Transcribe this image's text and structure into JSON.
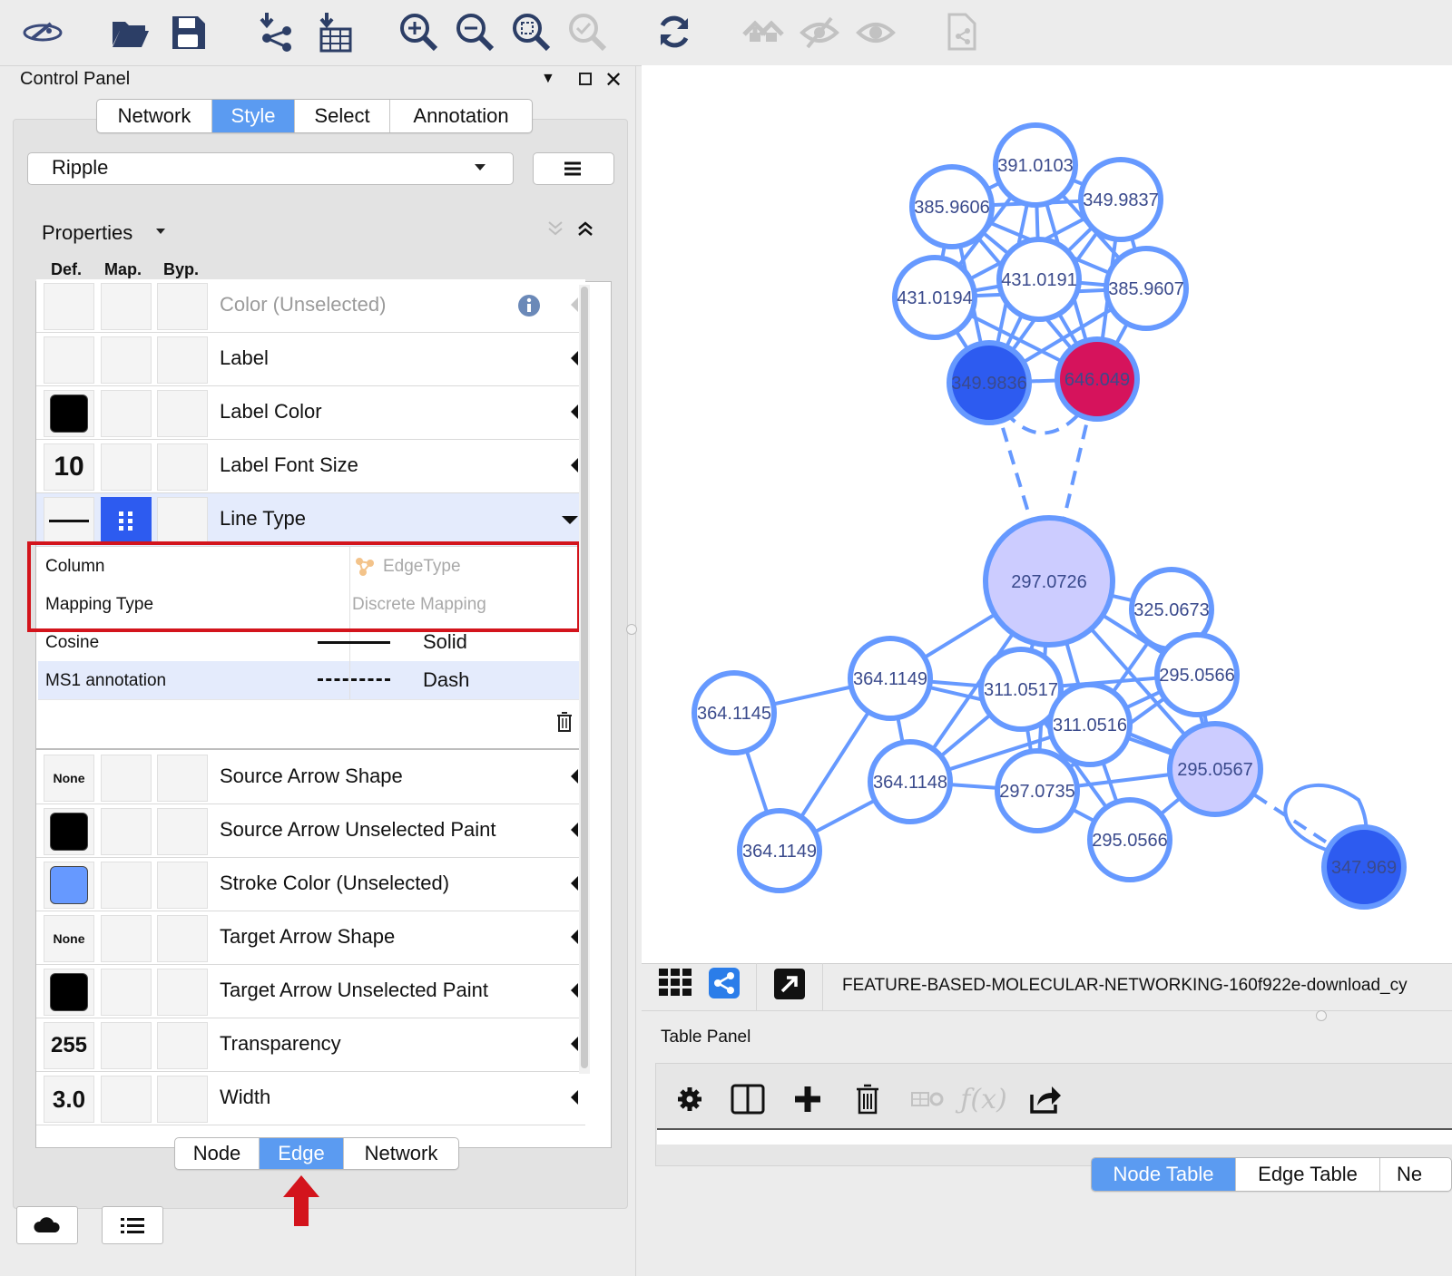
{
  "control_panel": {
    "title": "Control Panel",
    "top_tabs": [
      "Network",
      "Style",
      "Select",
      "Annotation"
    ],
    "active_top_tab": "Style",
    "style_name": "Ripple",
    "properties_label": "Properties",
    "column_headers": [
      "Def.",
      "Map.",
      "Byp."
    ],
    "properties": [
      {
        "label": "Color (Unselected)",
        "default": "",
        "disabled": true
      },
      {
        "label": "Label",
        "default": ""
      },
      {
        "label": "Label Color",
        "default_color": "#000000"
      },
      {
        "label": "Label Font Size",
        "default": "10"
      },
      {
        "label": "Line Type",
        "expanded": true
      },
      {
        "label": "Source Arrow Shape",
        "default": "None"
      },
      {
        "label": "Source Arrow Unselected Paint",
        "default_color": "#000000"
      },
      {
        "label": "Stroke Color (Unselected)",
        "default_color": "#6699ff"
      },
      {
        "label": "Target Arrow Shape",
        "default": "None"
      },
      {
        "label": "Target Arrow Unselected Paint",
        "default_color": "#000000"
      },
      {
        "label": "Transparency",
        "default": "255"
      },
      {
        "label": "Width",
        "default": "3.0"
      }
    ],
    "mapping": {
      "column_label": "Column",
      "column_value": "EdgeType",
      "mapping_type_label": "Mapping Type",
      "mapping_type_value": "Discrete Mapping",
      "entries": [
        {
          "key": "Cosine",
          "value": "Solid"
        },
        {
          "key": "MS1 annotation",
          "value": "Dash"
        }
      ]
    },
    "bottom_tabs": [
      "Node",
      "Edge",
      "Network"
    ],
    "active_bottom_tab": "Edge"
  },
  "network_view": {
    "title": "FEATURE-BASED-MOLECULAR-NETWORKING-160f922e-download_cy",
    "nodes": [
      {
        "id": "n1",
        "label": "391.0103",
        "kind": "plain"
      },
      {
        "id": "n2",
        "label": "385.9606",
        "kind": "plain"
      },
      {
        "id": "n3",
        "label": "349.9837",
        "kind": "plain"
      },
      {
        "id": "n4",
        "label": "431.0194",
        "kind": "plain"
      },
      {
        "id": "n5",
        "label": "431.0191",
        "kind": "plain"
      },
      {
        "id": "n6",
        "label": "385.9607",
        "kind": "plain"
      },
      {
        "id": "n7",
        "label": "349.9836",
        "kind": "blue"
      },
      {
        "id": "n8",
        "label": "646.049",
        "kind": "magenta"
      },
      {
        "id": "n9",
        "label": "297.0726",
        "kind": "lavender"
      },
      {
        "id": "n10",
        "label": "325.0673",
        "kind": "plain"
      },
      {
        "id": "n11",
        "label": "364.1149",
        "kind": "plain"
      },
      {
        "id": "n12",
        "label": "311.0517",
        "kind": "plain"
      },
      {
        "id": "n13",
        "label": "295.0566",
        "kind": "plain"
      },
      {
        "id": "n14",
        "label": "364.1145",
        "kind": "plain"
      },
      {
        "id": "n15",
        "label": "311.0516",
        "kind": "plain"
      },
      {
        "id": "n16",
        "label": "295.0567",
        "kind": "lavender"
      },
      {
        "id": "n17",
        "label": "364.1148",
        "kind": "plain"
      },
      {
        "id": "n18",
        "label": "297.0735",
        "kind": "plain"
      },
      {
        "id": "n19",
        "label": "295.0566",
        "kind": "plain"
      },
      {
        "id": "n20",
        "label": "364.1149",
        "kind": "plain"
      },
      {
        "id": "n21",
        "label": "347.969",
        "kind": "blue"
      }
    ]
  },
  "table_panel": {
    "title": "Table Panel",
    "tabs": [
      "Node Table",
      "Edge Table",
      "Ne"
    ],
    "active_tab": "Node Table"
  },
  "colors": {
    "accent": "#5b9bf1",
    "edge": "#6699ff",
    "node_blue": "#2d5bf0",
    "node_magenta": "#d6135c",
    "node_lavender": "#ccccff",
    "node_label": "#3a4a8c",
    "highlight_red": "#d3141c"
  }
}
